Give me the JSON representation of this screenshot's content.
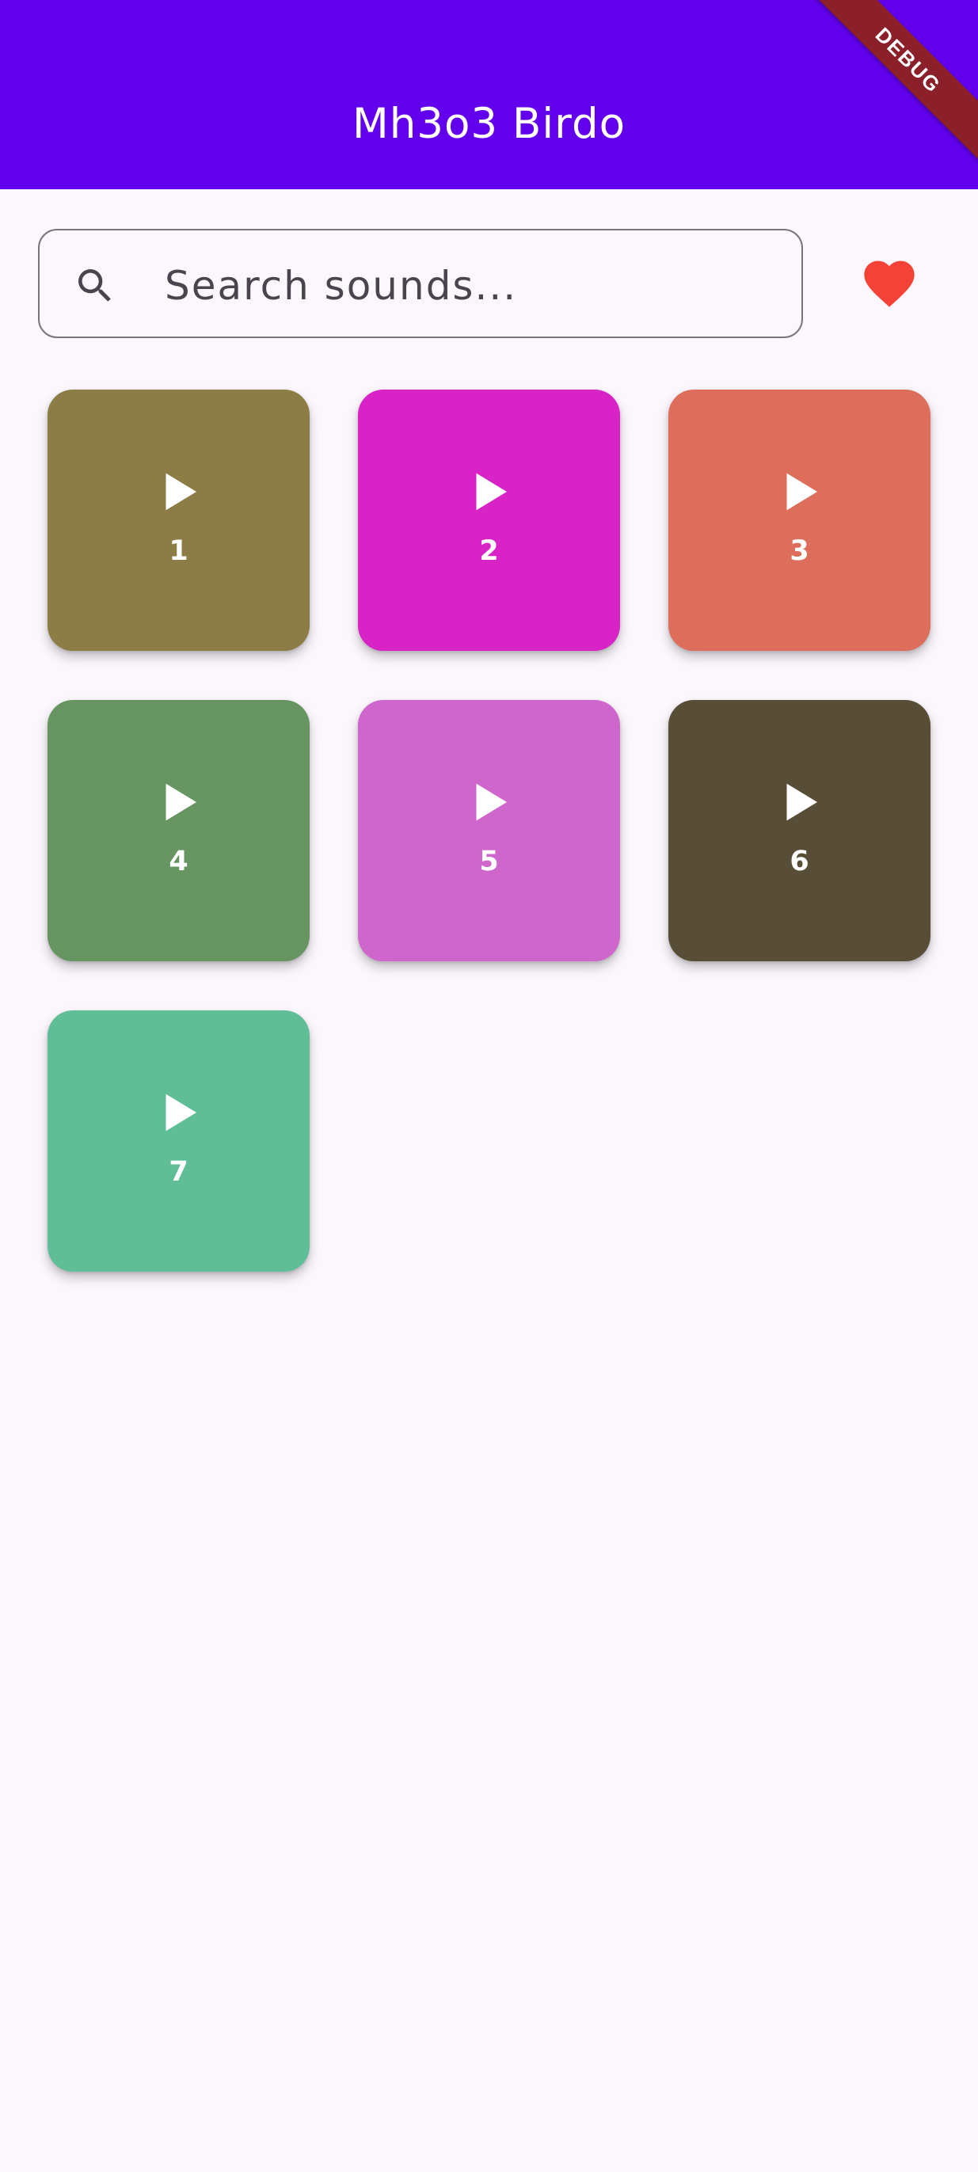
{
  "app_bar": {
    "title": "Mh3o3 Birdo",
    "background": "#6200ee",
    "debug_banner": "DEBUG"
  },
  "search": {
    "placeholder": "Search sounds...",
    "value": "",
    "icon": "search-icon"
  },
  "favorites": {
    "icon": "heart-icon",
    "color": "#f44336"
  },
  "sounds": [
    {
      "label": "1",
      "color": "#8b7d45",
      "icon": "play-icon"
    },
    {
      "label": "2",
      "color": "#d823c6",
      "icon": "play-icon"
    },
    {
      "label": "3",
      "color": "#dc6e5b",
      "icon": "play-icon"
    },
    {
      "label": "4",
      "color": "#669561",
      "icon": "play-icon"
    },
    {
      "label": "5",
      "color": "#cf66cb",
      "icon": "play-icon"
    },
    {
      "label": "6",
      "color": "#584d37",
      "icon": "play-icon"
    },
    {
      "label": "7",
      "color": "#60be97",
      "icon": "play-icon"
    }
  ]
}
